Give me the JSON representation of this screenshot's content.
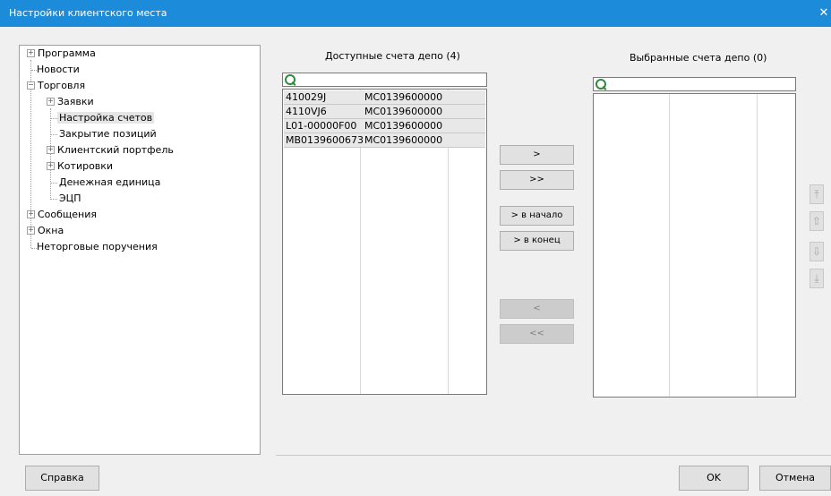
{
  "window": {
    "title": "Настройки клиентского места",
    "close_glyph": "✕"
  },
  "tree": {
    "items": [
      {
        "label": "Программа",
        "level": 0,
        "expander": "+"
      },
      {
        "label": "Новости",
        "level": 0,
        "expander": ""
      },
      {
        "label": "Торговля",
        "level": 0,
        "expander": "−"
      },
      {
        "label": "Заявки",
        "level": 1,
        "expander": "+"
      },
      {
        "label": "Настройка счетов",
        "level": 1,
        "expander": "",
        "selected": true
      },
      {
        "label": "Закрытие позиций",
        "level": 1,
        "expander": ""
      },
      {
        "label": "Клиентский портфель",
        "level": 1,
        "expander": "+"
      },
      {
        "label": "Котировки",
        "level": 1,
        "expander": "+"
      },
      {
        "label": "Денежная единица",
        "level": 1,
        "expander": ""
      },
      {
        "label": "ЭЦП",
        "level": 1,
        "expander": ""
      },
      {
        "label": "Сообщения",
        "level": 0,
        "expander": "+"
      },
      {
        "label": "Окна",
        "level": 0,
        "expander": "+"
      },
      {
        "label": "Неторговые поручения",
        "level": 0,
        "expander": ""
      }
    ]
  },
  "available": {
    "label": "Доступные счета депо (4)",
    "rows": [
      {
        "account": "410029J",
        "code": "MC0139600000"
      },
      {
        "account": "4110VJ6",
        "code": "MC0139600000"
      },
      {
        "account": "L01-00000F00",
        "code": "MC0139600000"
      },
      {
        "account": "MB0139600673",
        "code": "MC0139600000"
      }
    ]
  },
  "selected": {
    "label": "Выбранные счета депо (0)"
  },
  "transfer_buttons": {
    "add": ">",
    "add_all": ">>",
    "to_start": "> в начало",
    "to_end": "> в конец",
    "remove": "<",
    "remove_all": "<<"
  },
  "order_buttons": {
    "top_icon": "⤒",
    "up_icon": "⇧",
    "down_icon": "⇩",
    "bottom_icon": "⤓"
  },
  "footer": {
    "help": "Справка",
    "ok": "OK",
    "cancel": "Отмена"
  },
  "colors": {
    "titlebar": "#1c8bd9",
    "search_icon": "#2e8b3d"
  }
}
